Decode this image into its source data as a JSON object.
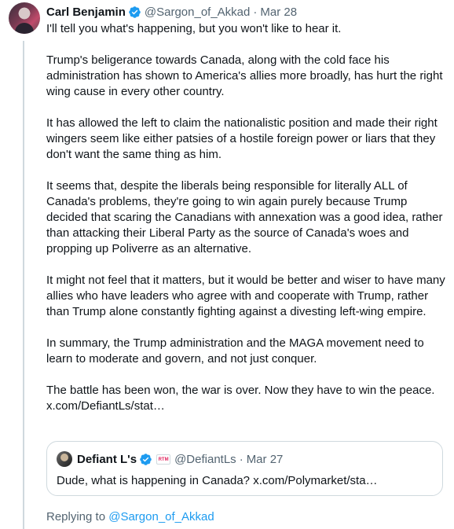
{
  "author": {
    "name": "Carl Benjamin",
    "handle": "@Sargon_of_Akkad",
    "separator": "·",
    "date": "Mar 28"
  },
  "tweet": {
    "paragraphs": [
      "I'll tell you what's happening, but you won't like to hear it.",
      "Trump's beligerance towards Canada, along with the cold face his administration has shown to America's allies more broadly, has hurt the right wing cause in every other country.",
      "It has allowed the left to claim the nationalistic position and made their right wingers seem like either patsies of a hostile foreign power or liars that they don't want the same thing as him.",
      "It seems that, despite the liberals being responsible for literally ALL of Canada's problems, they're going to win again purely because Trump decided that scaring the Canadians with annexation was a good idea, rather than attacking their Liberal Party as the source of Canada's woes and propping up Poliverre as an alternative.",
      "It might not feel that it matters, but it would be better and wiser to have many allies who have leaders who agree with and cooperate with Trump, rather than Trump alone constantly fighting against a  divesting left-wing empire.",
      "In summary, the Trump administration and the MAGA movement need to learn to moderate and govern, and not just conquer."
    ],
    "closing": "The battle has been won, the war is over. Now they have to win the peace.",
    "link": "x.com/DefiantLs/stat…"
  },
  "quote": {
    "name": "Defiant L's",
    "badge": "RTM",
    "handle": "@DefiantLs",
    "separator": "·",
    "date": "Mar 27",
    "text": "Dude, what is happening in Canada? ",
    "link": "x.com/Polymarket/sta…"
  },
  "reply": {
    "prefix": "Replying to ",
    "handle": "@Sargon_of_Akkad"
  },
  "colors": {
    "accent": "#1d9bf0",
    "text": "#0f1419",
    "muted": "#536471",
    "border": "#cfd9de"
  },
  "icons": {
    "verified": "verified-badge-icon",
    "quote_badge": "affiliate-badge-icon"
  }
}
